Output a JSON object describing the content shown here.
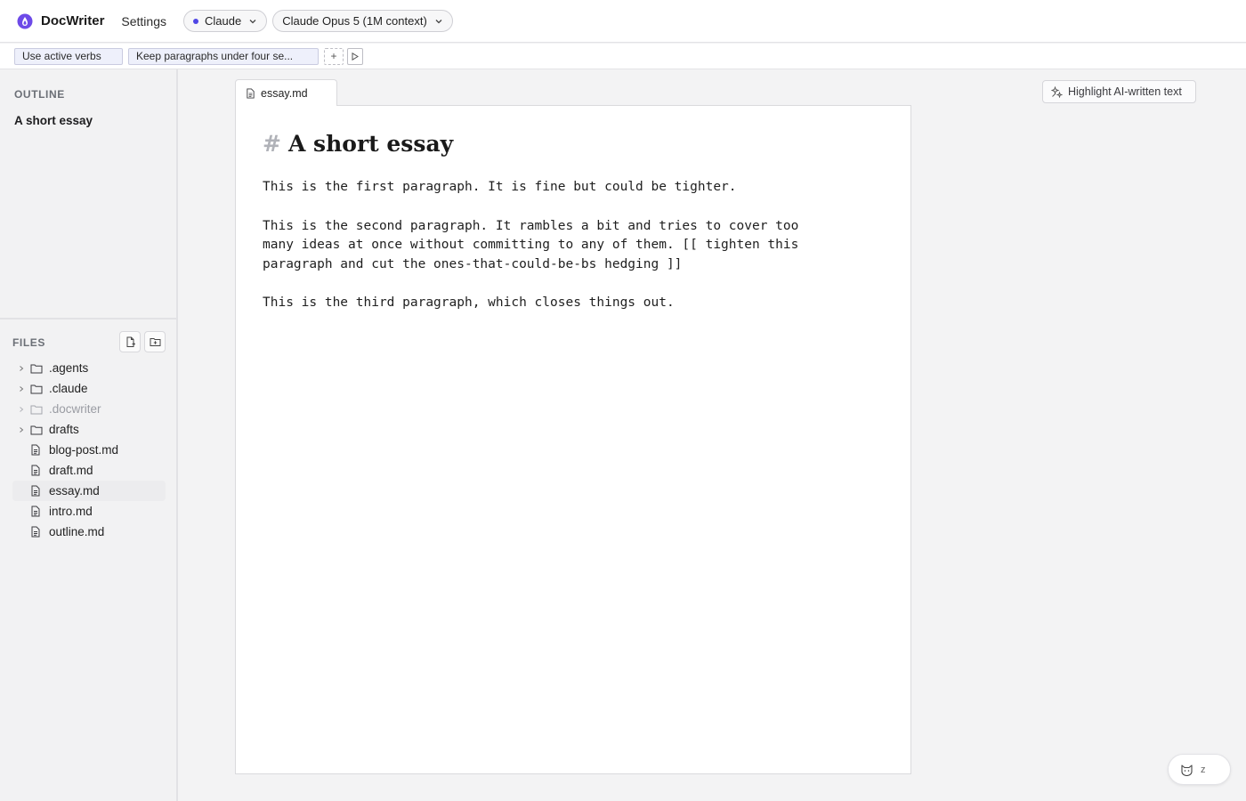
{
  "app": {
    "title": "DocWriter",
    "settings_label": "Settings"
  },
  "header": {
    "provider": {
      "label": "Claude",
      "dot_color": "#4f46e5"
    },
    "model": {
      "label": "Claude Opus 5 (1M context)"
    }
  },
  "rules": {
    "chips": [
      "Use active verbs",
      "Keep paragraphs under four se..."
    ],
    "add_label": "+",
    "run_label": "▷"
  },
  "outline": {
    "label": "OUTLINE",
    "items": [
      "A short essay"
    ]
  },
  "files": {
    "label": "FILES",
    "tree": [
      {
        "name": ".agents",
        "type": "folder",
        "dim": false
      },
      {
        "name": ".claude",
        "type": "folder",
        "dim": false
      },
      {
        "name": ".docwriter",
        "type": "folder",
        "dim": true
      },
      {
        "name": "drafts",
        "type": "folder",
        "dim": false
      },
      {
        "name": "blog-post.md",
        "type": "file",
        "active": false
      },
      {
        "name": "draft.md",
        "type": "file",
        "active": false
      },
      {
        "name": "essay.md",
        "type": "file",
        "active": true
      },
      {
        "name": "intro.md",
        "type": "file",
        "active": false
      },
      {
        "name": "outline.md",
        "type": "file",
        "active": false
      }
    ]
  },
  "editor": {
    "tab_label": "essay.md",
    "heading_hash": "#",
    "heading": "A short essay",
    "paragraphs": [
      "This is the first paragraph. It is fine but could be tighter.",
      "This is the second paragraph. It rambles a bit and tries to cover too many ideas at once without committing to any of them. [[ tighten this paragraph and cut the ones-that-could-be-bs hedging ]]",
      "This is the third paragraph, which closes things out."
    ]
  },
  "toolbar": {
    "highlight_label": "Highlight AI-written text"
  },
  "agent_fab": {
    "key_label": "z"
  },
  "colors": {
    "accent": "#6d4ae8",
    "chip_bg": "#eef0fb",
    "chip_border": "#c9cbe0"
  }
}
